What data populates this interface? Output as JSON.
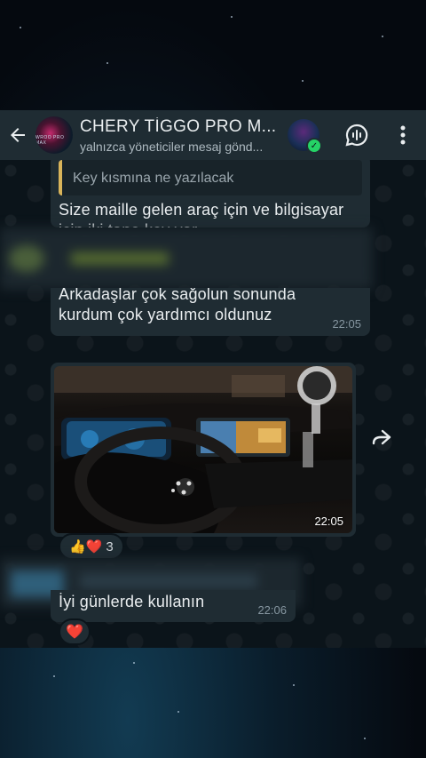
{
  "header": {
    "back_icon": "arrow-left-icon",
    "title": "CHERY TİGGO PRO M...",
    "subtitle": "yalnızca yöneticiler mesaj gönd...",
    "avatar_text": "WROO PRO MAX",
    "voice_icon": "voice-chat-icon",
    "menu_icon": "more-vertical-icon"
  },
  "messages": [
    {
      "quote": "Key kısmına ne yazılacak",
      "text": "Size maille gelen araç için ve bilgisayar için iki tane key var"
    },
    {
      "text_line1": "Arkadaşlar çok sağolun sonunda",
      "text_line2": "kurdum çok yardımcı oldunuz",
      "time": "22:05"
    },
    {
      "type": "image",
      "time": "22:05",
      "reactions": {
        "emojis": "👍❤️",
        "count": "3"
      }
    },
    {
      "text": "İyi günlerde kullanın",
      "time": "22:06",
      "reaction": "❤️"
    }
  ],
  "colors": {
    "header_bg": "#1f2c33",
    "chat_bg": "#0b141a",
    "bubble_bg": "#1f2c33",
    "quote_bar": "#d9b45a",
    "verified": "#25d366",
    "heart": "#e8313a"
  }
}
